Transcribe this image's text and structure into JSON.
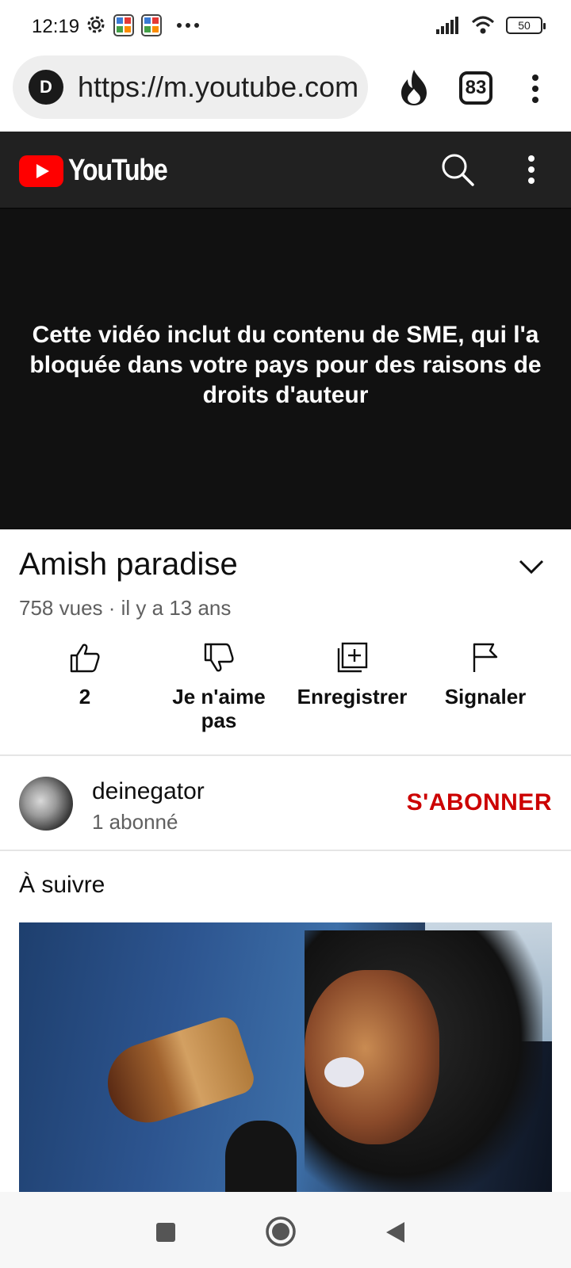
{
  "status_bar": {
    "time": "12:19",
    "battery": "50",
    "icons": [
      "gear-icon",
      "app-icon",
      "app-icon",
      "more-dots-icon",
      "signal-icon",
      "wifi-icon",
      "battery-icon"
    ]
  },
  "browser": {
    "site_badge": "D",
    "url": "https://m.youtube.com",
    "tab_count": "83",
    "icons": [
      "fire-icon",
      "tabs-icon",
      "overflow-menu-icon"
    ]
  },
  "youtube_header": {
    "logo_text": "YouTube",
    "brand_color": "#ff0000",
    "icons": [
      "search-icon",
      "overflow-menu-icon"
    ]
  },
  "player": {
    "message": "Cette vidéo inclut du contenu de SME, qui l'a bloquée dans votre pays pour des raisons de droits d'auteur"
  },
  "video": {
    "title": "Amish paradise",
    "meta": "758 vues · il y a 13 ans"
  },
  "actions": {
    "like": "2",
    "dislike": "Je n'aime pas",
    "save": "Enregistrer",
    "report": "Signaler"
  },
  "channel": {
    "name": "deinegator",
    "subscribers": "1 abonné",
    "subscribe": "S'ABONNER",
    "subscribe_color": "#cc0000"
  },
  "up_next": {
    "heading": "À suivre"
  }
}
